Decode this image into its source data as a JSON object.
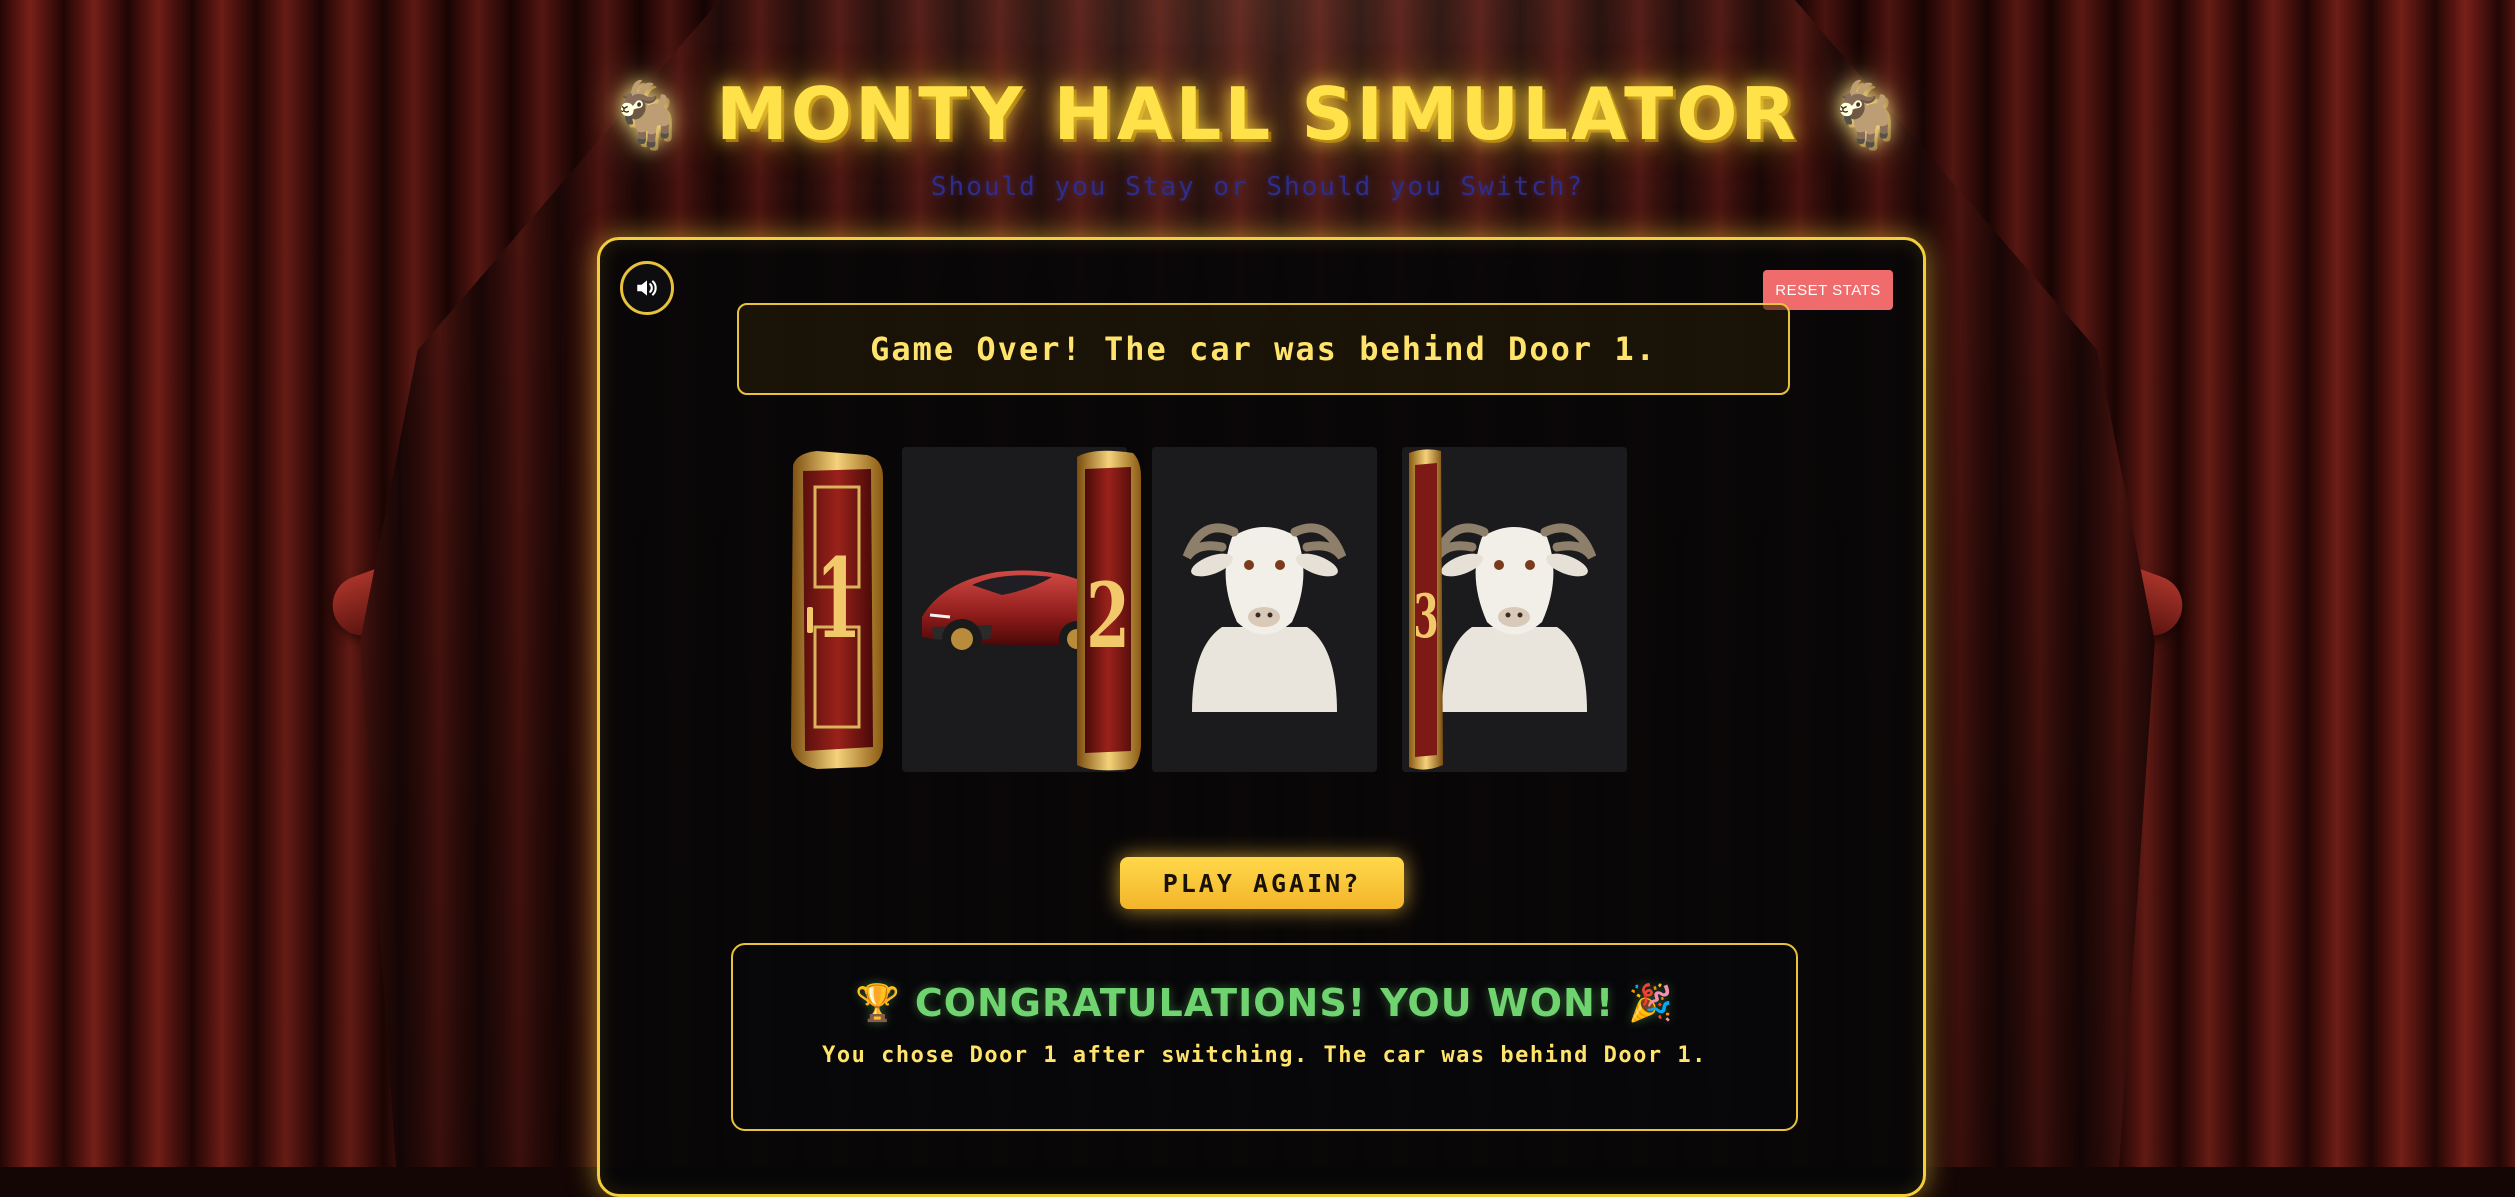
{
  "app": {
    "title": "MONTY HALL SIMULATOR",
    "title_emoji_left": "🐐",
    "title_emoji_right": "🐐",
    "subtitle": "Should you Stay or Should you Switch?"
  },
  "controls": {
    "sound_icon": "speaker-icon",
    "reset_label": "RESET STATS",
    "play_again_label": "PLAY AGAIN?"
  },
  "message": "Game Over! The car was behind Door 1.",
  "doors": [
    {
      "number": "1",
      "state": "open",
      "prize": "car"
    },
    {
      "number": "2",
      "state": "open",
      "prize": "goat"
    },
    {
      "number": "3",
      "state": "open",
      "prize": "goat"
    }
  ],
  "result": {
    "trophy": "🏆",
    "party": "🎉",
    "heading": "CONGRATULATIONS! YOU WON!",
    "detail": "You chose Door 1 after switching. The car was behind Door 1."
  },
  "colors": {
    "accent_gold": "#f2cf3a",
    "title_yellow": "#ffe24a",
    "subtitle_blue": "#2e2d8c",
    "win_green": "#6fd36f",
    "reset_red": "#f06b6b",
    "door_red": "#8a1d18"
  }
}
